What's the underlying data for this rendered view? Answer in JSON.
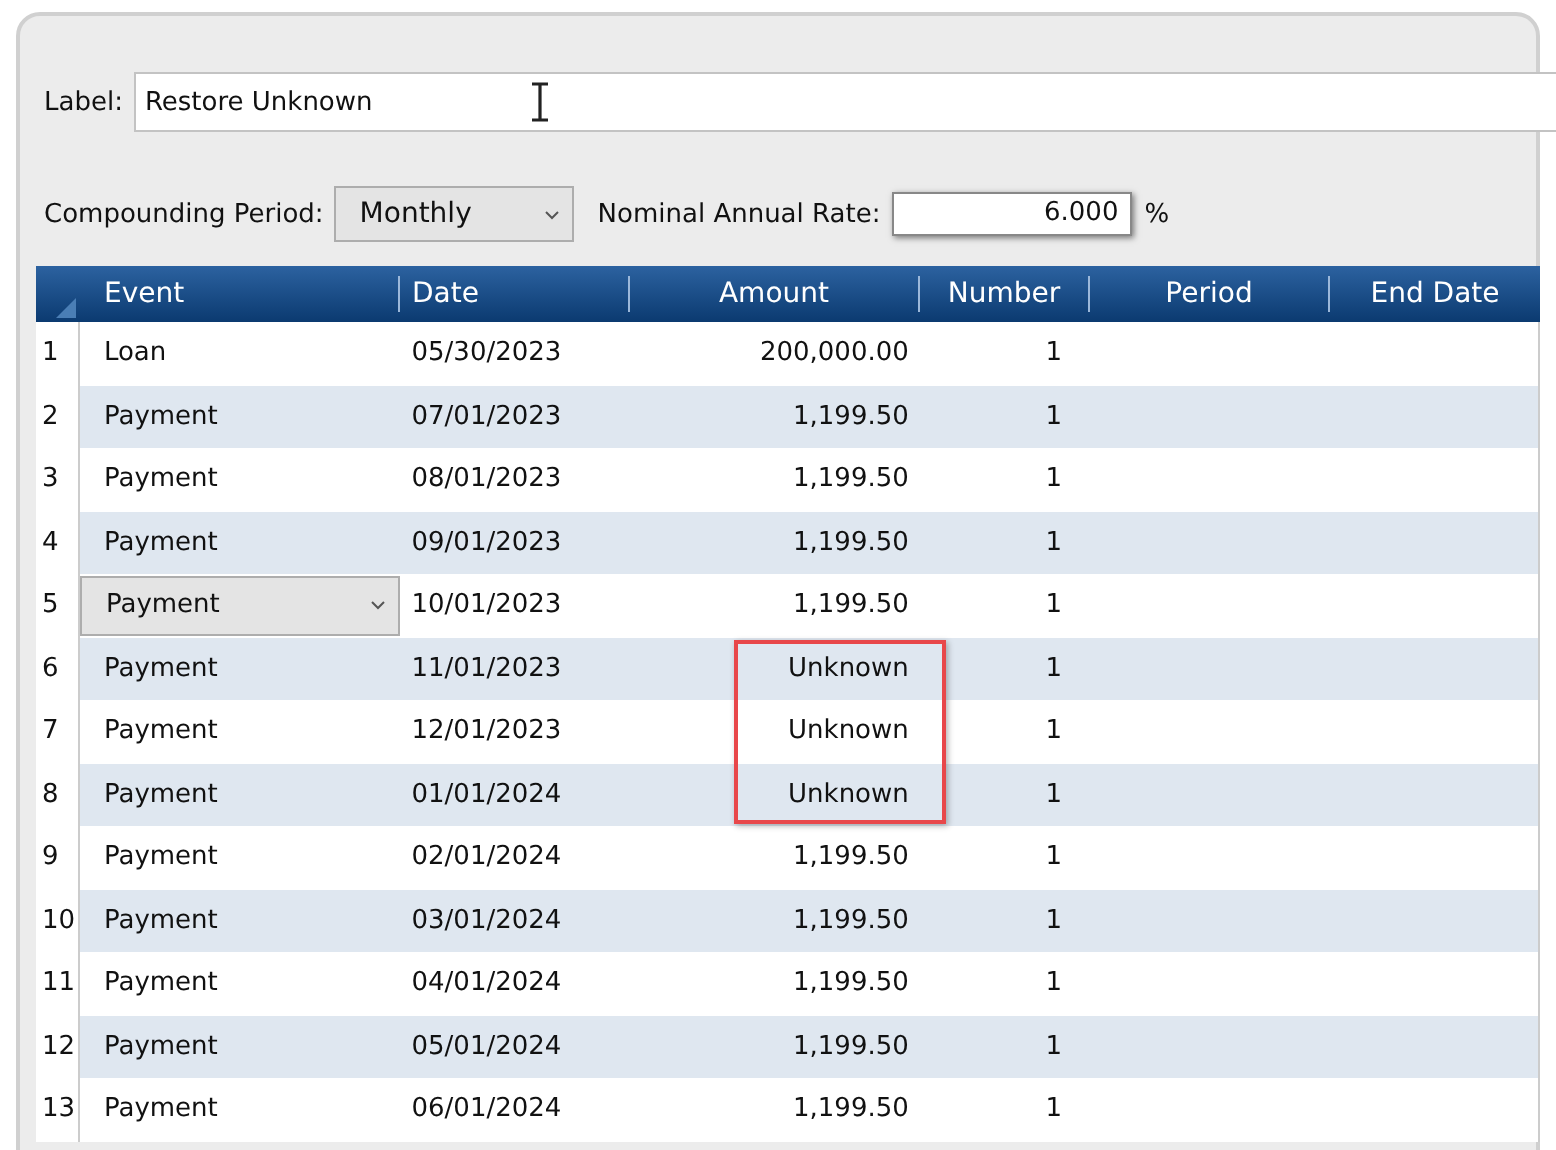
{
  "label_field": {
    "label": "Label:",
    "value": "Restore Unknown"
  },
  "compounding": {
    "label": "Compounding Period:",
    "value": "Monthly"
  },
  "rate": {
    "label": "Nominal Annual Rate:",
    "value": "6.000",
    "unit": "%"
  },
  "table": {
    "columns": [
      "Event",
      "Date",
      "Amount",
      "Number",
      "Period",
      "End Date"
    ],
    "rows": [
      {
        "index": "1",
        "event": "Loan",
        "kind": "text",
        "date": "05/30/2023",
        "amount": "200,000.00",
        "number": "1",
        "highlighted": false
      },
      {
        "index": "2",
        "event": "Payment",
        "kind": "text",
        "date": "07/01/2023",
        "amount": "1,199.50",
        "number": "1",
        "highlighted": false
      },
      {
        "index": "3",
        "event": "Payment",
        "kind": "text",
        "date": "08/01/2023",
        "amount": "1,199.50",
        "number": "1",
        "highlighted": false
      },
      {
        "index": "4",
        "event": "Payment",
        "kind": "text",
        "date": "09/01/2023",
        "amount": "1,199.50",
        "number": "1",
        "highlighted": false
      },
      {
        "index": "5",
        "event": "Payment",
        "kind": "dropdown",
        "date": "10/01/2023",
        "amount": "1,199.50",
        "number": "1",
        "highlighted": false
      },
      {
        "index": "6",
        "event": "Payment",
        "kind": "text",
        "date": "11/01/2023",
        "amount": "Unknown",
        "number": "1",
        "highlighted": true
      },
      {
        "index": "7",
        "event": "Payment",
        "kind": "text",
        "date": "12/01/2023",
        "amount": "Unknown",
        "number": "1",
        "highlighted": true
      },
      {
        "index": "8",
        "event": "Payment",
        "kind": "text",
        "date": "01/01/2024",
        "amount": "Unknown",
        "number": "1",
        "highlighted": true
      },
      {
        "index": "9",
        "event": "Payment",
        "kind": "text",
        "date": "02/01/2024",
        "amount": "1,199.50",
        "number": "1",
        "highlighted": false
      },
      {
        "index": "10",
        "event": "Payment",
        "kind": "text",
        "date": "03/01/2024",
        "amount": "1,199.50",
        "number": "1",
        "highlighted": false
      },
      {
        "index": "11",
        "event": "Payment",
        "kind": "text",
        "date": "04/01/2024",
        "amount": "1,199.50",
        "number": "1",
        "highlighted": false
      },
      {
        "index": "12",
        "event": "Payment",
        "kind": "text",
        "date": "05/01/2024",
        "amount": "1,199.50",
        "number": "1",
        "highlighted": false
      },
      {
        "index": "13",
        "event": "Payment",
        "kind": "text",
        "date": "06/01/2024",
        "amount": "1,199.50",
        "number": "1",
        "highlighted": false
      }
    ]
  }
}
